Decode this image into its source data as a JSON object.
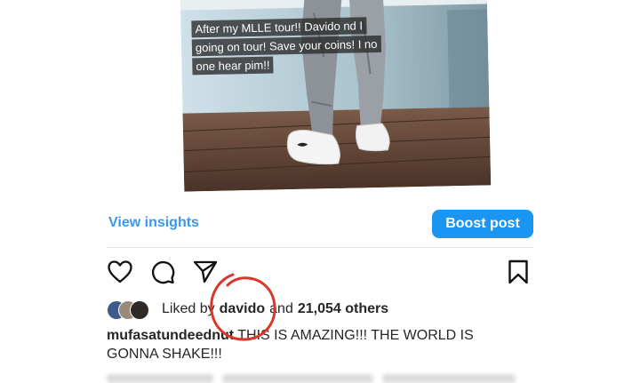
{
  "post": {
    "image_caption_lines": [
      "After my MLLE tour!! Davido nd I",
      "going on tour! Save your coins! I no",
      "one hear pim!!"
    ]
  },
  "actions": {
    "view_insights_label": "View insights",
    "boost_post_label": "Boost post"
  },
  "icons": {
    "like": "heart-icon",
    "comment": "comment-icon",
    "share": "send-icon",
    "save": "bookmark-icon"
  },
  "likes": {
    "liked_by_prefix": "Liked by",
    "username": "davido",
    "conjunction": "and",
    "others_count": "21,054 others"
  },
  "caption": {
    "username": "mufasatundeednut",
    "text": "THIS IS AMAZING!!! THE WORLD IS GONNA SHAKE!!!"
  },
  "colors": {
    "accent_blue": "#1b95f2",
    "link_blue": "#3897f0",
    "annotation_red": "#d9372b"
  }
}
